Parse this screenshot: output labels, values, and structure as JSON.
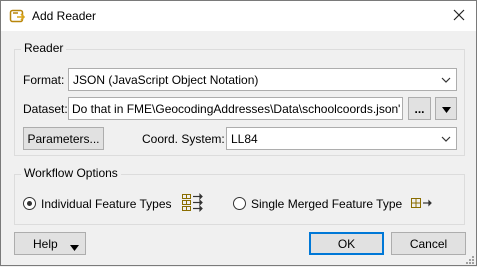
{
  "window": {
    "title": "Add Reader",
    "icon": "add-reader-icon",
    "close_icon": "close-icon"
  },
  "reader_group": {
    "title": "Reader",
    "format_label": "Format:",
    "format_value": "JSON (JavaScript Object Notation)",
    "dataset_label": "Dataset:",
    "dataset_value": "Do that in FME\\GeocodingAddresses\\Data\\schoolcoords.json\"",
    "browse_label": "...",
    "parameters_label": "Parameters...",
    "coord_label": "Coord. System:",
    "coord_value": "LL84"
  },
  "workflow_group": {
    "title": "Workflow Options",
    "option_individual": "Individual Feature Types",
    "option_merged": "Single Merged Feature Type",
    "selected": "individual"
  },
  "footer": {
    "help_label": "Help",
    "ok_label": "OK",
    "cancel_label": "Cancel"
  },
  "colors": {
    "default_button_border": "#0078d7",
    "group_border": "#dcdcdc",
    "icon_accent": "#b8860b"
  }
}
